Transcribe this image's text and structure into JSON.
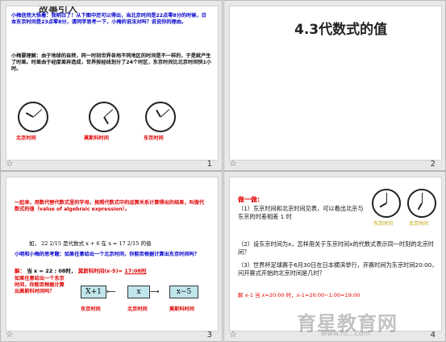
{
  "slides": [
    {
      "number": "1",
      "top_cut_text": "故事引入",
      "intro": "小梅信然大悟着：我明白了！从下图中还可以得出，当北京时间是22点零8分的时候，日本东京时间是23点零8分，请同学思考一下，小梅的说法对吗？说说你的理由。",
      "body": "小梅要理解：由于地球的自转，同一时刻世界各地不同地区的时间是不一样的，于是就产生了时差。时差由于经度差异造成，世界按经线划分了24个时区，东京时间比北京时间快1小时。",
      "clock_labels": [
        "北京时间",
        "莫斯科时间",
        "东京时间"
      ]
    },
    {
      "number": "2",
      "title": "4.3代数式的值"
    },
    {
      "number": "3",
      "intro": "一起来，用数代替代数式里的字母，按照代数式中的运算关系计算得出的结果，叫做代数式的值（value of algebraic expression）。",
      "example_prefix": "如，",
      "example_a": "22",
      "example_a_frac": "2/15",
      "example_mid": "是代数式 x + 6 在 x = 17",
      "example_b_frac": "2/15",
      "example_suffix": "的值",
      "note": "小明和小梅的思考题：如果任意给出一个北京时间，你能否根据计算出东京时间吗？",
      "answer_label": "解：",
      "answer_text": "当 x = 22 : 08时，",
      "answer_text2": "莫斯科时间(x-5)=",
      "answer_value": "17:08时",
      "side_note": "如果任意给出一个东京时间，你能否根据计算出莫斯科时间吗？",
      "box_left": "X+1",
      "box_mid": "x",
      "box_right": "x−5",
      "bottom_labels": [
        "东京时间",
        "北京时间",
        "莫斯科时间"
      ]
    },
    {
      "number": "4",
      "heading": "做一做:",
      "lines": [
        "（1）东京时间和北京时间见表，可以看出北京与东京的时差相差 1 时",
        "（2）设东京时间为x，怎样用关于东京时间x的代数式表示同一时刻的北京时间？",
        "（3）世界杯足球赛于6月30日在日本横滨举行，开赛时间为东京时间20:00，问开赛式开始的北京时间是几时？"
      ],
      "answer": "解 x-1 当 x=20:00 时，x-1=20:00−1:00=19:00",
      "clock_labels": [
        "东京时间",
        "北京时间"
      ]
    }
  ],
  "watermark": "育星教育网",
  "watermark_url": "www.ht...com",
  "colors": {
    "blue": "#0000cc",
    "red": "#e00000",
    "box": "#bfe6ea"
  }
}
